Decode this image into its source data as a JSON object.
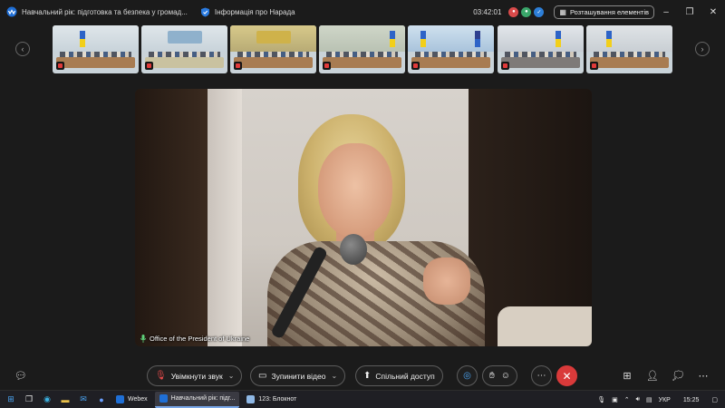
{
  "window": {
    "meeting_title": "Навчальний рік: підготовка та безпека у громад...",
    "info_label": "Інформація про Нарада",
    "timer": "03:42:01",
    "layout_button": "Розташування елементів",
    "controls": [
      "minimize",
      "restore",
      "close"
    ]
  },
  "thumbnails": {
    "prev_icon": "chevron-left-icon",
    "next_icon": "chevron-right-icon",
    "count": 7
  },
  "video": {
    "speaker_label": "Office of the President of Ukraine"
  },
  "controls": {
    "mute_label": "Увімкнути звук",
    "video_label": "Зупинити відео",
    "share_label": "Спільний доступ",
    "end_icon": "close-icon",
    "more_icon": "ellipsis-icon"
  },
  "taskbar": {
    "webex_label": "Webex",
    "meeting_label": "Навчальний рік: підг...",
    "notepad_label": "123: Блокнот",
    "language": "УКР",
    "time": "15:25"
  },
  "colors": {
    "background": "#1b1b1b",
    "end_call": "#d93a3a",
    "accent": "#78a6e8"
  }
}
